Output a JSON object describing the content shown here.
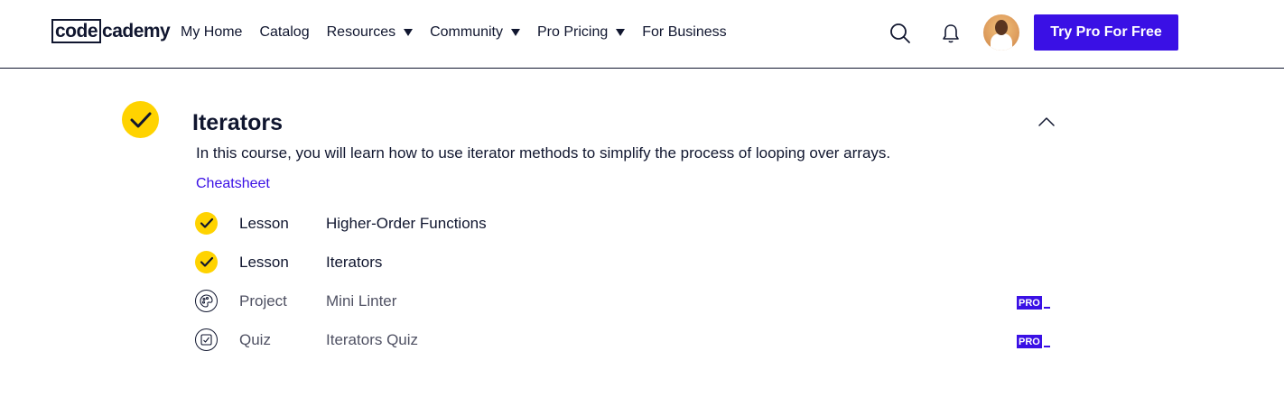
{
  "header": {
    "logo": {
      "part1": "code",
      "part2": "cademy"
    },
    "nav": [
      {
        "label": "My Home",
        "dropdown": false
      },
      {
        "label": "Catalog",
        "dropdown": false
      },
      {
        "label": "Resources",
        "dropdown": true
      },
      {
        "label": "Community",
        "dropdown": true
      },
      {
        "label": "Pro Pricing",
        "dropdown": true
      },
      {
        "label": "For Business",
        "dropdown": false
      }
    ],
    "icons": {
      "search": "search-icon",
      "notifications": "bell-icon"
    },
    "cta_label": "Try Pro For Free"
  },
  "module": {
    "title": "Iterators",
    "description": "In this course, you will learn how to use iterator methods to simplify the process of looping over arrays.",
    "cheatsheet_label": "Cheatsheet",
    "completed": true,
    "items": [
      {
        "type": "Lesson",
        "name": "Higher-Order Functions",
        "status": "complete"
      },
      {
        "type": "Lesson",
        "name": "Iterators",
        "status": "complete"
      },
      {
        "type": "Project",
        "name": "Mini Linter",
        "status": "locked",
        "badge": "PRO",
        "icon": "project-icon"
      },
      {
        "type": "Quiz",
        "name": "Iterators Quiz",
        "status": "locked",
        "badge": "PRO",
        "icon": "quiz-icon"
      }
    ]
  },
  "colors": {
    "brand": "#3a10e5",
    "accent_yellow": "#ffd300",
    "text": "#10162f"
  }
}
